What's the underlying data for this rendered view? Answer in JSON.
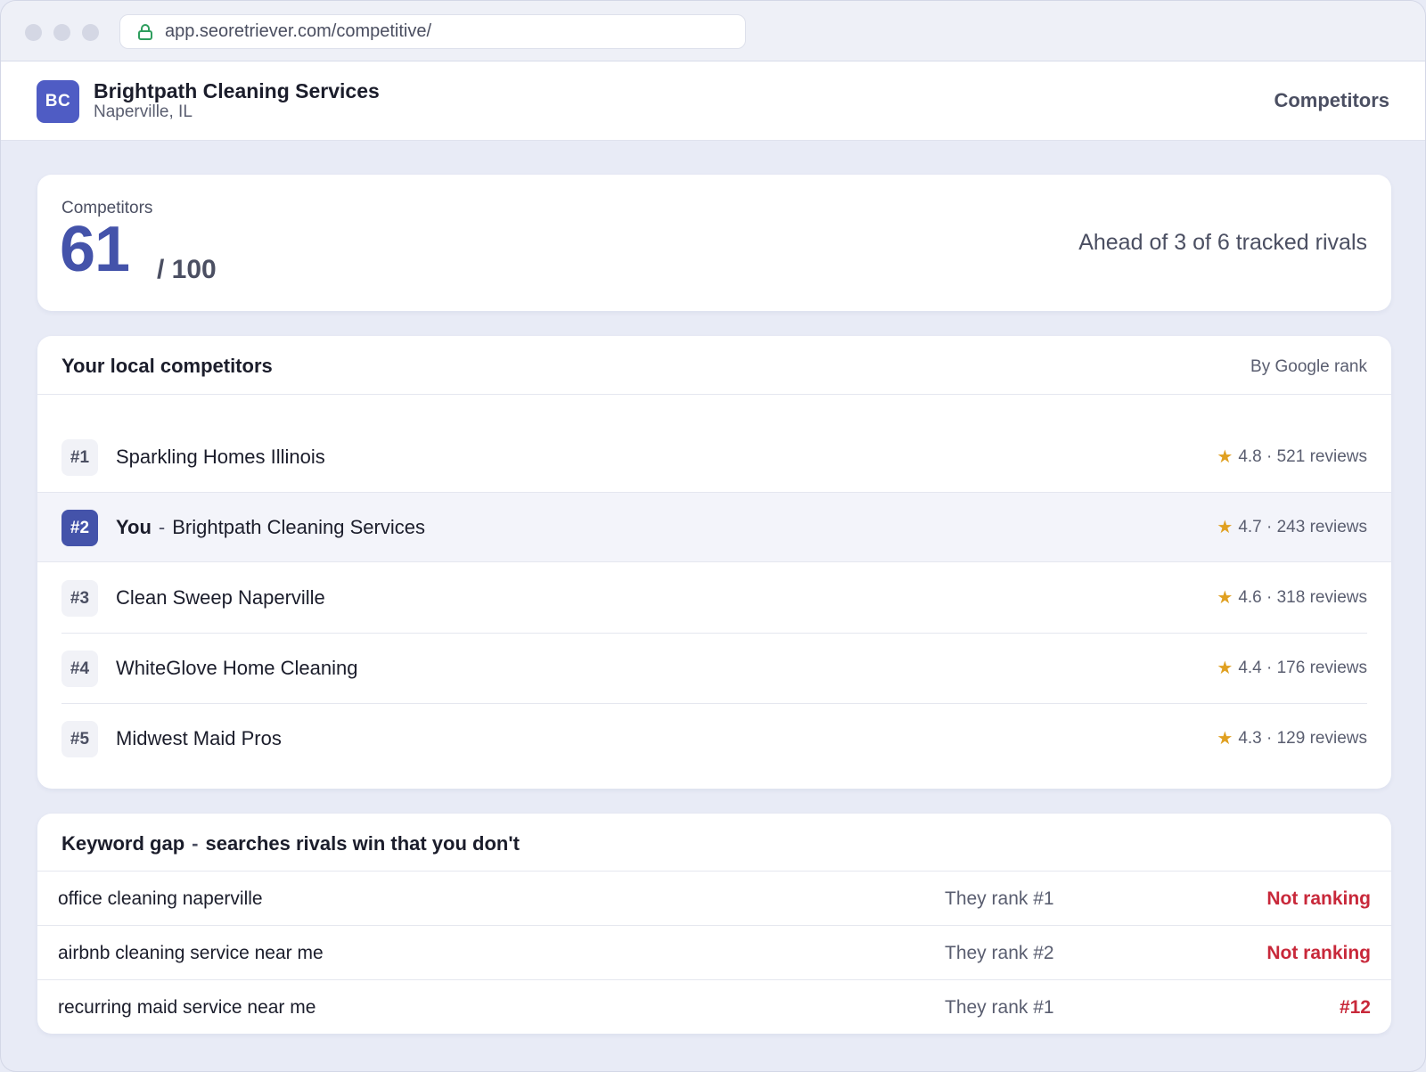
{
  "browser": {
    "url": "app.seoretriever.com/competitive/"
  },
  "header": {
    "avatar_initials": "BC",
    "business_name": "Brightpath Cleaning Services",
    "location": "Naperville, IL",
    "nav_active": "Competitors"
  },
  "score": {
    "label": "Competitors",
    "value": "61",
    "max": "/ 100",
    "summary": "Ahead of 3 of 6 tracked rivals"
  },
  "competitors": {
    "title": "Your local competitors",
    "sort_label": "By Google rank",
    "rows": [
      {
        "rank": "#1",
        "name": "Sparkling Homes Illinois",
        "meta": "4.8 · 521 reviews"
      },
      {
        "rank": "#2",
        "you_label": "You",
        "separator": "-",
        "name": "Brightpath Cleaning Services",
        "meta": "4.7 · 243 reviews"
      },
      {
        "rank": "#3",
        "name": "Clean Sweep Naperville",
        "meta": "4.6 · 318 reviews"
      },
      {
        "rank": "#4",
        "name": "WhiteGlove Home Cleaning",
        "meta": "4.4 · 176 reviews"
      },
      {
        "rank": "#5",
        "name": "Midwest Maid Pros",
        "meta": "4.3 · 129 reviews"
      }
    ]
  },
  "keyword_gap": {
    "title": "Keyword gap",
    "separator": "-",
    "subtitle": "searches rivals win that you don't",
    "rows": [
      {
        "keyword": "office cleaning naperville",
        "they": "They rank #1",
        "you": "Not ranking"
      },
      {
        "keyword": "airbnb cleaning service near me",
        "they": "They rank #2",
        "you": "Not ranking"
      },
      {
        "keyword": "recurring maid service near me",
        "they": "They rank #1",
        "you": "#12"
      }
    ]
  },
  "colors": {
    "accent": "#4453aa",
    "avatar": "#4f5cc4",
    "star": "#e0a020",
    "alert": "#c8283a",
    "secure": "#2f9e5e"
  },
  "icons": {
    "lock": "lock-icon",
    "star": "star-icon"
  }
}
